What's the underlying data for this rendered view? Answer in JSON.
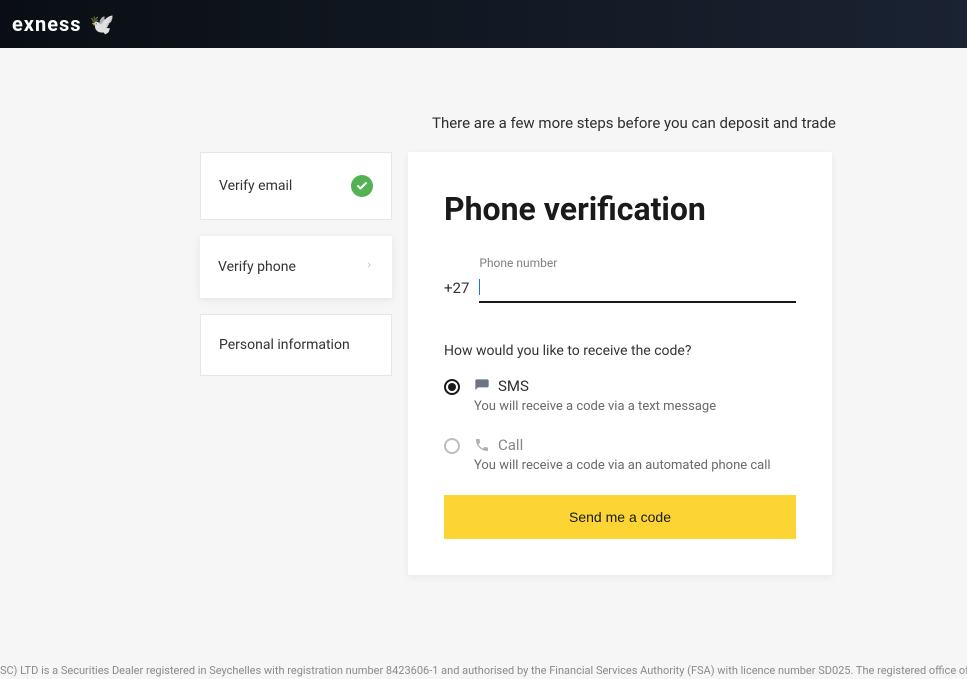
{
  "header": {
    "brand": "exness"
  },
  "intro": "There are a few more steps before you can deposit and trade",
  "steps": {
    "verify_email": "Verify email",
    "verify_phone": "Verify phone",
    "personal_info": "Personal information"
  },
  "card": {
    "title": "Phone verification",
    "phone_label": "Phone number",
    "prefix": "+27",
    "phone_value": "",
    "question": "How would you like to receive the code?",
    "sms": {
      "title": "SMS",
      "sub": "You will receive a code via a text message"
    },
    "call": {
      "title": "Call",
      "sub": "You will receive a code via an automated phone call"
    },
    "button": "Send me a code"
  },
  "footer": "SC) LTD is a Securities Dealer registered in Seychelles with registration number 8423606-1 and authorised by the Financial Services Authority (FSA) with licence number SD025. The registered office of"
}
